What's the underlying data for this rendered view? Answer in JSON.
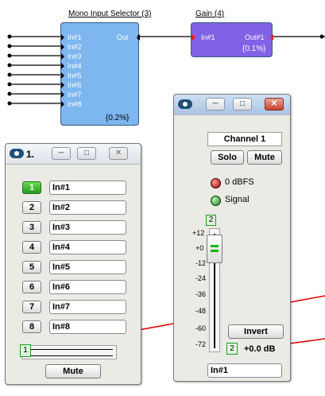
{
  "mono_block": {
    "title": "Mono Input Selector (3)",
    "inputs": [
      "In#1",
      "In#2",
      "In#3",
      "In#4",
      "In#5",
      "In#6",
      "In#7",
      "In#8"
    ],
    "output": "Out",
    "percent": "{0.2%}"
  },
  "gain_block": {
    "title": "Gain (4)",
    "input": "In#1",
    "output": "Out#1",
    "percent": "{0.1%}"
  },
  "selector_window": {
    "title": "1.",
    "rows": [
      {
        "number": "1",
        "value": "In#1",
        "selected": true
      },
      {
        "number": "2",
        "value": "In#2",
        "selected": false
      },
      {
        "number": "3",
        "value": "In#3",
        "selected": false
      },
      {
        "number": "4",
        "value": "In#4",
        "selected": false
      },
      {
        "number": "5",
        "value": "In#5",
        "selected": false
      },
      {
        "number": "6",
        "value": "In#6",
        "selected": false
      },
      {
        "number": "7",
        "value": "In#7",
        "selected": false
      },
      {
        "number": "8",
        "value": "In#8",
        "selected": false
      }
    ],
    "slider_value": "1",
    "mute_label": "Mute"
  },
  "gain_window": {
    "channel_label": "Channel 1",
    "solo_label": "Solo",
    "mute_label": "Mute",
    "clip_label": "0 dBFS",
    "signal_label": "Signal",
    "scale": [
      "+12",
      "+0",
      "-12",
      "-24",
      "-36",
      "-48",
      "-60",
      "-72"
    ],
    "top_value": "2",
    "invert_label": "Invert",
    "gain_box_value": "2",
    "gain_readout": "+0.0 dB",
    "input_field": "In#1"
  },
  "colors": {
    "block_fill": "#7eb6ef",
    "gain_fill": "#8062e6",
    "wire": "#000000",
    "pin_out_red": "#e8231a",
    "annotation_red": "#e00000",
    "selected_green": "#2fb12a"
  }
}
